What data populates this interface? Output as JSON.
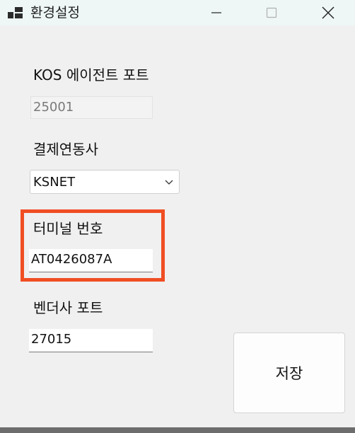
{
  "window": {
    "title": "환경설정",
    "icons": {
      "app": "app-window-icon",
      "minimize": "minimize-icon",
      "maximize": "maximize-icon",
      "close": "close-icon"
    }
  },
  "form": {
    "kos_port": {
      "label": "KOS 에이전트 포트",
      "value": "25001",
      "enabled": false
    },
    "payment_provider": {
      "label": "결제연동사",
      "selected": "KSNET",
      "icon": "chevron-down-icon"
    },
    "terminal_number": {
      "label": "터미널 번호",
      "value": "AT0426087A"
    },
    "vendor_port": {
      "label": "벤더사 포트",
      "value": "27015"
    }
  },
  "actions": {
    "save_label": "저장"
  },
  "colors": {
    "highlight": "#f04e23",
    "titlebar": "#eef6f6",
    "window_bg": "#f0f0f0"
  }
}
